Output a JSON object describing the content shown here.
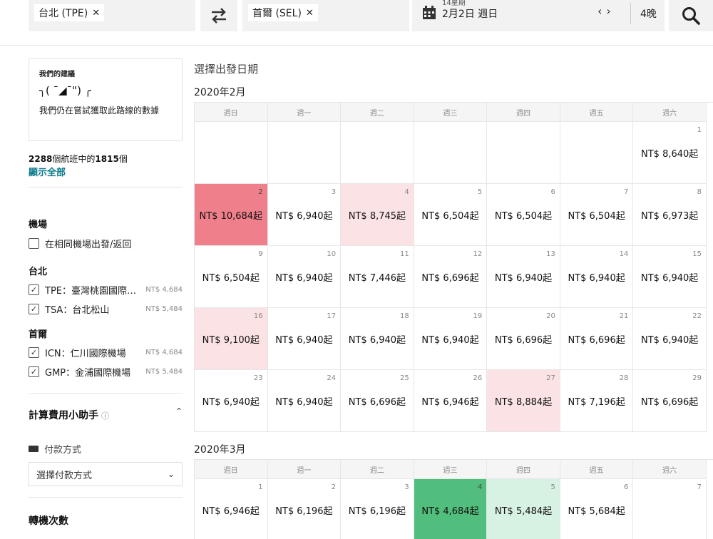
{
  "search": {
    "origin": "台北 (TPE)",
    "destination": "首爾 (SEL)",
    "date_top": "14星期",
    "date": "2月2日 週日",
    "nights": "4晚"
  },
  "sidebar": {
    "suggest_title": "我們的建議",
    "suggest_kaomoji": "╮( ¯◢¯\") ╭",
    "suggest_body": "我們仍在嘗試獲取此路線的數據",
    "count_a": "2288",
    "count_mid": "個航班中的",
    "count_b": "1815",
    "count_tail": "個",
    "show_all": "顯示全部",
    "airports_title": "機場",
    "same_airport": "在相同機場出發/返回",
    "taipei_title": "台北",
    "seoul_title": "首爾",
    "airports": {
      "tpe": {
        "label": "TPE：臺灣桃園國際機場",
        "price": "NT$ 4,684"
      },
      "tsa": {
        "label": "TSA：台北松山",
        "price": "NT$ 5,484"
      },
      "icn": {
        "label": "ICN：仁川國際機場",
        "price": "NT$ 4,684"
      },
      "gmp": {
        "label": "GMP：金浦國際機場",
        "price": "NT$ 5,484"
      }
    },
    "calc_title": "計算費用小助手",
    "pay_label": "付款方式",
    "pay_select": "選擇付款方式",
    "stops_title": "轉機次數"
  },
  "calendar": {
    "heading": "選擇出發日期",
    "weekdays": [
      "週日",
      "週一",
      "週二",
      "週三",
      "週四",
      "週五",
      "週六"
    ],
    "feb": {
      "title": "2020年2月",
      "cells": [
        {
          "d": "",
          "p": "",
          "hl": ""
        },
        {
          "d": "",
          "p": "",
          "hl": ""
        },
        {
          "d": "",
          "p": "",
          "hl": ""
        },
        {
          "d": "",
          "p": "",
          "hl": ""
        },
        {
          "d": "",
          "p": "",
          "hl": ""
        },
        {
          "d": "",
          "p": "",
          "hl": ""
        },
        {
          "d": "1",
          "p": "NT$ 8,640起",
          "hl": ""
        },
        {
          "d": "2",
          "p": "NT$ 10,684起",
          "hl": "red"
        },
        {
          "d": "3",
          "p": "NT$ 6,940起",
          "hl": ""
        },
        {
          "d": "4",
          "p": "NT$ 8,745起",
          "hl": "pink"
        },
        {
          "d": "5",
          "p": "NT$ 6,504起",
          "hl": ""
        },
        {
          "d": "6",
          "p": "NT$ 6,504起",
          "hl": ""
        },
        {
          "d": "7",
          "p": "NT$ 6,504起",
          "hl": ""
        },
        {
          "d": "8",
          "p": "NT$ 6,973起",
          "hl": ""
        },
        {
          "d": "9",
          "p": "NT$ 6,504起",
          "hl": ""
        },
        {
          "d": "10",
          "p": "NT$ 6,940起",
          "hl": ""
        },
        {
          "d": "11",
          "p": "NT$ 7,446起",
          "hl": ""
        },
        {
          "d": "12",
          "p": "NT$ 6,696起",
          "hl": ""
        },
        {
          "d": "13",
          "p": "NT$ 6,940起",
          "hl": ""
        },
        {
          "d": "14",
          "p": "NT$ 6,940起",
          "hl": ""
        },
        {
          "d": "15",
          "p": "NT$ 6,940起",
          "hl": ""
        },
        {
          "d": "16",
          "p": "NT$ 9,100起",
          "hl": "pink"
        },
        {
          "d": "17",
          "p": "NT$ 6,940起",
          "hl": ""
        },
        {
          "d": "18",
          "p": "NT$ 6,940起",
          "hl": ""
        },
        {
          "d": "19",
          "p": "NT$ 6,940起",
          "hl": ""
        },
        {
          "d": "20",
          "p": "NT$ 6,696起",
          "hl": ""
        },
        {
          "d": "21",
          "p": "NT$ 6,696起",
          "hl": ""
        },
        {
          "d": "22",
          "p": "NT$ 6,940起",
          "hl": ""
        },
        {
          "d": "23",
          "p": "NT$ 6,940起",
          "hl": ""
        },
        {
          "d": "24",
          "p": "NT$ 6,940起",
          "hl": ""
        },
        {
          "d": "25",
          "p": "NT$ 6,696起",
          "hl": ""
        },
        {
          "d": "26",
          "p": "NT$ 6,946起",
          "hl": ""
        },
        {
          "d": "27",
          "p": "NT$ 8,884起",
          "hl": "pink"
        },
        {
          "d": "28",
          "p": "NT$ 7,196起",
          "hl": ""
        },
        {
          "d": "29",
          "p": "NT$ 6,696起",
          "hl": ""
        }
      ]
    },
    "mar": {
      "title": "2020年3月",
      "cells": [
        {
          "d": "1",
          "p": "NT$ 6,946起",
          "hl": ""
        },
        {
          "d": "2",
          "p": "NT$ 6,196起",
          "hl": ""
        },
        {
          "d": "3",
          "p": "NT$ 6,196起",
          "hl": ""
        },
        {
          "d": "4",
          "p": "NT$ 4,684起",
          "hl": "green"
        },
        {
          "d": "5",
          "p": "NT$ 5,484起",
          "hl": "lgreen"
        },
        {
          "d": "6",
          "p": "NT$ 5,684起",
          "hl": ""
        },
        {
          "d": "7",
          "p": "",
          "hl": ""
        }
      ]
    }
  }
}
